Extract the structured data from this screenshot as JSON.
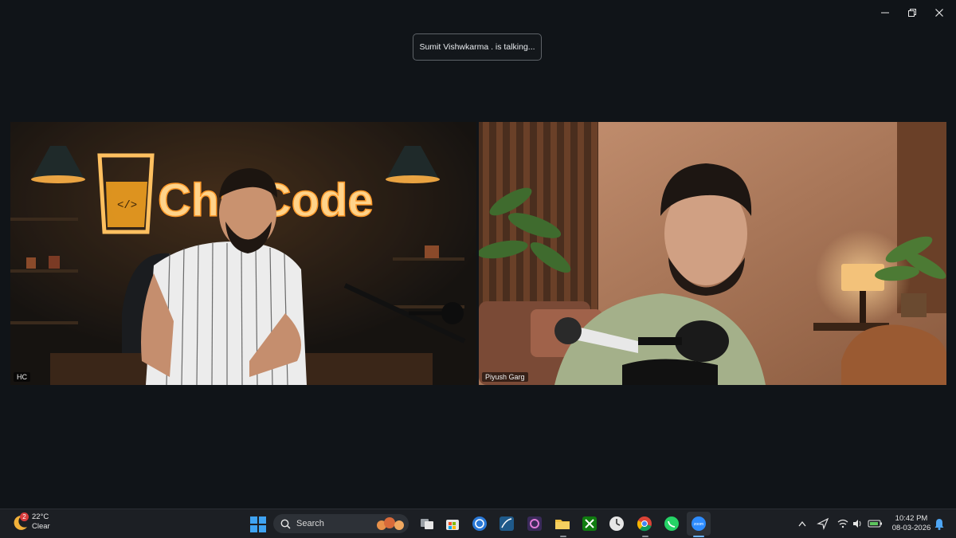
{
  "toast": {
    "text": "Sumit Vishwkarma . is talking..."
  },
  "participants": [
    {
      "label": "HC",
      "neon_sign": "ChaiCode"
    },
    {
      "label": "Piyush Garg"
    }
  ],
  "taskbar": {
    "weather": {
      "temp": "22°C",
      "condition": "Clear",
      "badge": "2"
    },
    "search_label": "Search",
    "apps": [
      "task-view",
      "microsoft-store",
      "edge-alt",
      "mysql-workbench",
      "vscode-like",
      "file-explorer",
      "xbox",
      "clock",
      "chrome",
      "whatsapp",
      "zoom"
    ],
    "clock": {
      "time": "10:42 PM",
      "date": "08-03-2026"
    }
  },
  "colors": {
    "background": "#101418",
    "taskbar": "#1c1f24",
    "accent_zoom": "#2d8cff"
  }
}
